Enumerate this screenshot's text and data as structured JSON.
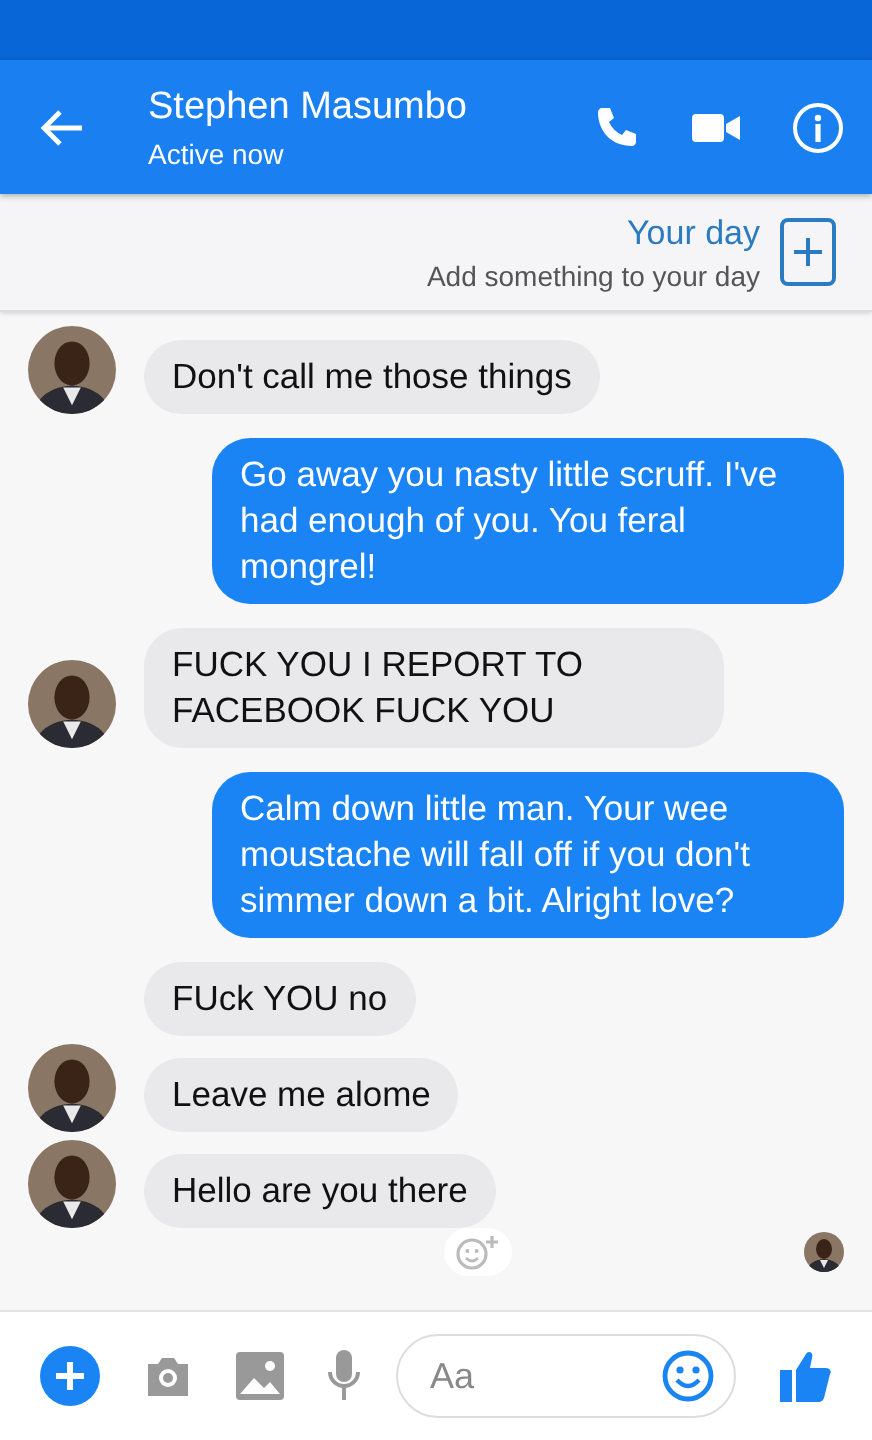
{
  "header": {
    "name": "Stephen Masumbo",
    "status": "Active now"
  },
  "story": {
    "title": "Your day",
    "subtitle": "Add something to your day"
  },
  "messages": [
    {
      "kind": "received",
      "text": "Don't call me those things",
      "avatar": true
    },
    {
      "kind": "sent",
      "text": "Go away you nasty little scruff. I've had enough of you. You feral mongrel!",
      "avatar": false
    },
    {
      "kind": "received",
      "text": "FUCK YOU I REPORT TO FACEBOOK FUCK YOU",
      "avatar": true
    },
    {
      "kind": "sent",
      "text": "Calm down little man. Your wee moustache will fall off if you don't simmer down a bit. Alright love?",
      "avatar": false
    },
    {
      "kind": "received",
      "text": "FUck YOU no",
      "avatar": false
    },
    {
      "kind": "received",
      "text": "Leave me alome",
      "avatar": true
    },
    {
      "kind": "received",
      "text": "Hello are you there",
      "avatar": true
    }
  ],
  "composer": {
    "placeholder": "Aa"
  }
}
